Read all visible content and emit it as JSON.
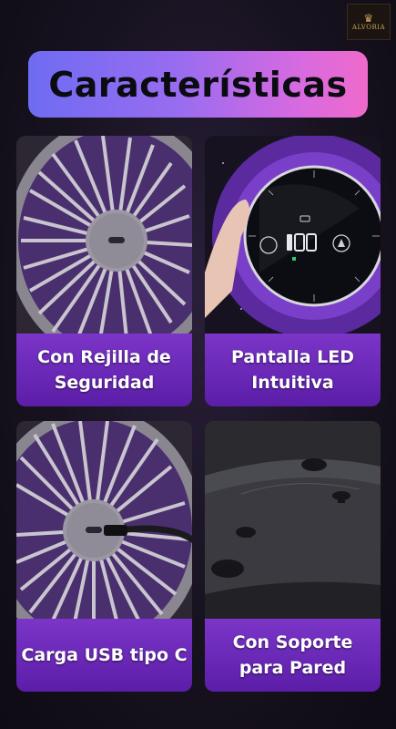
{
  "logo": {
    "text": "ALVORIA",
    "crown": "♛"
  },
  "title": "Características",
  "cards": [
    {
      "caption": "Con Rejilla de Seguridad",
      "image": "fan-grille-closeup"
    },
    {
      "caption": "Pantalla LED Intuitiva",
      "image": "led-touch-display"
    },
    {
      "caption": "Carga USB tipo C",
      "image": "usb-c-charging"
    },
    {
      "caption": "Con Soporte para Pared",
      "image": "wall-mount-base"
    }
  ],
  "display": {
    "readout": "100"
  },
  "colors": {
    "accent_purple": "#7b35c8",
    "title_gradient_start": "#6e6cf2",
    "title_gradient_end": "#ef6acb"
  }
}
